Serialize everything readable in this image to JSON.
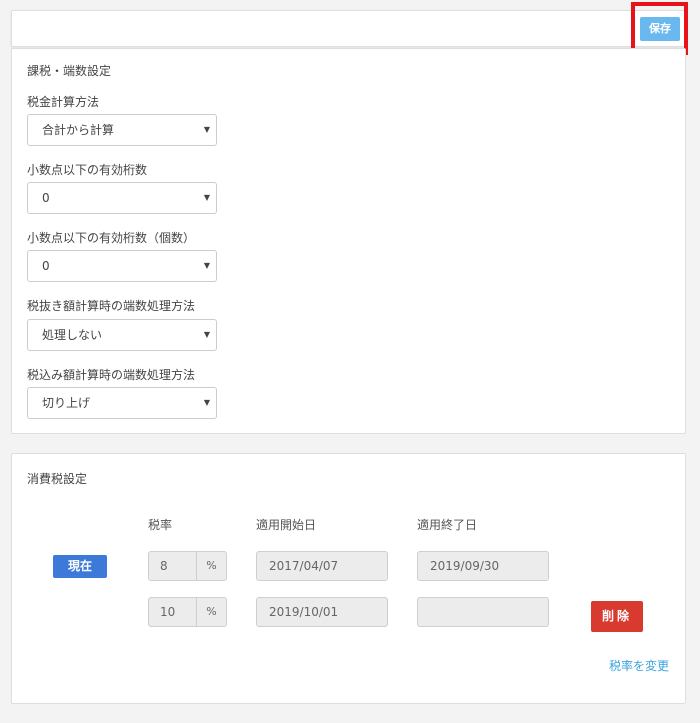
{
  "header": {
    "save_label": "保存"
  },
  "rounding": {
    "section_title": "課税・端数設定",
    "fields": [
      {
        "label": "税金計算方法",
        "value": "合計から計算"
      },
      {
        "label": "小数点以下の有効桁数",
        "value": "0"
      },
      {
        "label": "小数点以下の有効桁数（個数）",
        "value": "0"
      },
      {
        "label": "税抜き額計算時の端数処理方法",
        "value": "処理しない"
      },
      {
        "label": "税込み額計算時の端数処理方法",
        "value": "切り上げ"
      }
    ]
  },
  "consumption_tax": {
    "section_title": "消費税設定",
    "headers": {
      "rate": "税率",
      "start": "適用開始日",
      "end": "適用終了日"
    },
    "current_label": "現在",
    "rows": [
      {
        "rate": "8",
        "unit": "%",
        "start": "2017/04/07",
        "end": "2019/09/30"
      },
      {
        "rate": "10",
        "unit": "%",
        "start": "2019/10/01",
        "end": ""
      }
    ],
    "delete_label": "削除",
    "change_link": "税率を変更"
  },
  "annotation": {
    "highlight_color": "#e8121b"
  },
  "icons": {
    "dropdown": "caret-down-icon"
  }
}
